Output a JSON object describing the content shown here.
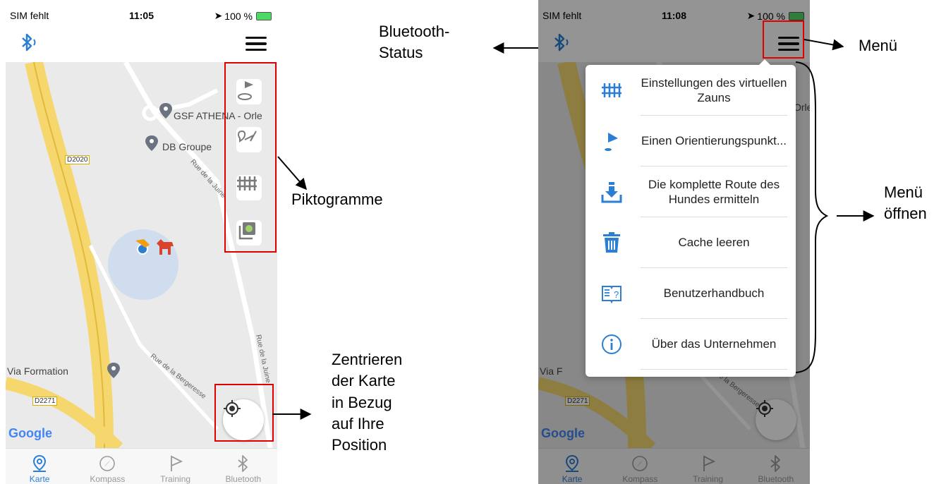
{
  "status_left": {
    "carrier": "SIM fehlt",
    "time": "11:05",
    "battery": "100 %"
  },
  "status_right": {
    "carrier": "SIM fehlt",
    "time": "11:08",
    "battery": "100 %"
  },
  "map": {
    "places": [
      "GSF ATHENA - Orle",
      "DB Groupe",
      "Via Formation"
    ],
    "roads": [
      "D2020",
      "D2271"
    ],
    "streets": [
      "Rue de la Juine",
      "Rue de la Bergeresse",
      "Rue de la Juine"
    ],
    "right_places": [
      "Orle",
      "Via F"
    ],
    "right_streets": [
      "Rue de la Bergeresse"
    ],
    "google": "Google"
  },
  "tabs": [
    {
      "label": "Karte",
      "icon": "map-pin-icon",
      "active": true
    },
    {
      "label": "Kompass",
      "icon": "compass-icon",
      "active": false
    },
    {
      "label": "Training",
      "icon": "flag-icon",
      "active": false
    },
    {
      "label": "Bluetooth",
      "icon": "bluetooth-icon",
      "active": false
    }
  ],
  "menu": [
    {
      "label": "Einstellungen des virtuellen Zauns",
      "icon": "fence-icon"
    },
    {
      "label": "Einen Orientierungspunkt...",
      "icon": "flag-pin-icon"
    },
    {
      "label": "Die komplette Route des Hundes ermitteln",
      "icon": "download-icon"
    },
    {
      "label": "Cache leeren",
      "icon": "trash-icon"
    },
    {
      "label": "Benutzerhandbuch",
      "icon": "book-icon"
    },
    {
      "label": "Über das Unternehmen",
      "icon": "info-icon"
    }
  ],
  "annotations": {
    "bluetooth_status": "Bluetooth-\nStatus",
    "menu": "Menü",
    "pictograms": "Piktogramme",
    "menu_open": "Menü\nöffnen",
    "center_map": "Zentrieren\nder Karte\nin Bezug\nauf Ihre\nPosition"
  },
  "colors": {
    "accent": "#2a7fd4",
    "highlight": "#e00000",
    "road": "#f5d76e",
    "map": "#eaeaea"
  }
}
